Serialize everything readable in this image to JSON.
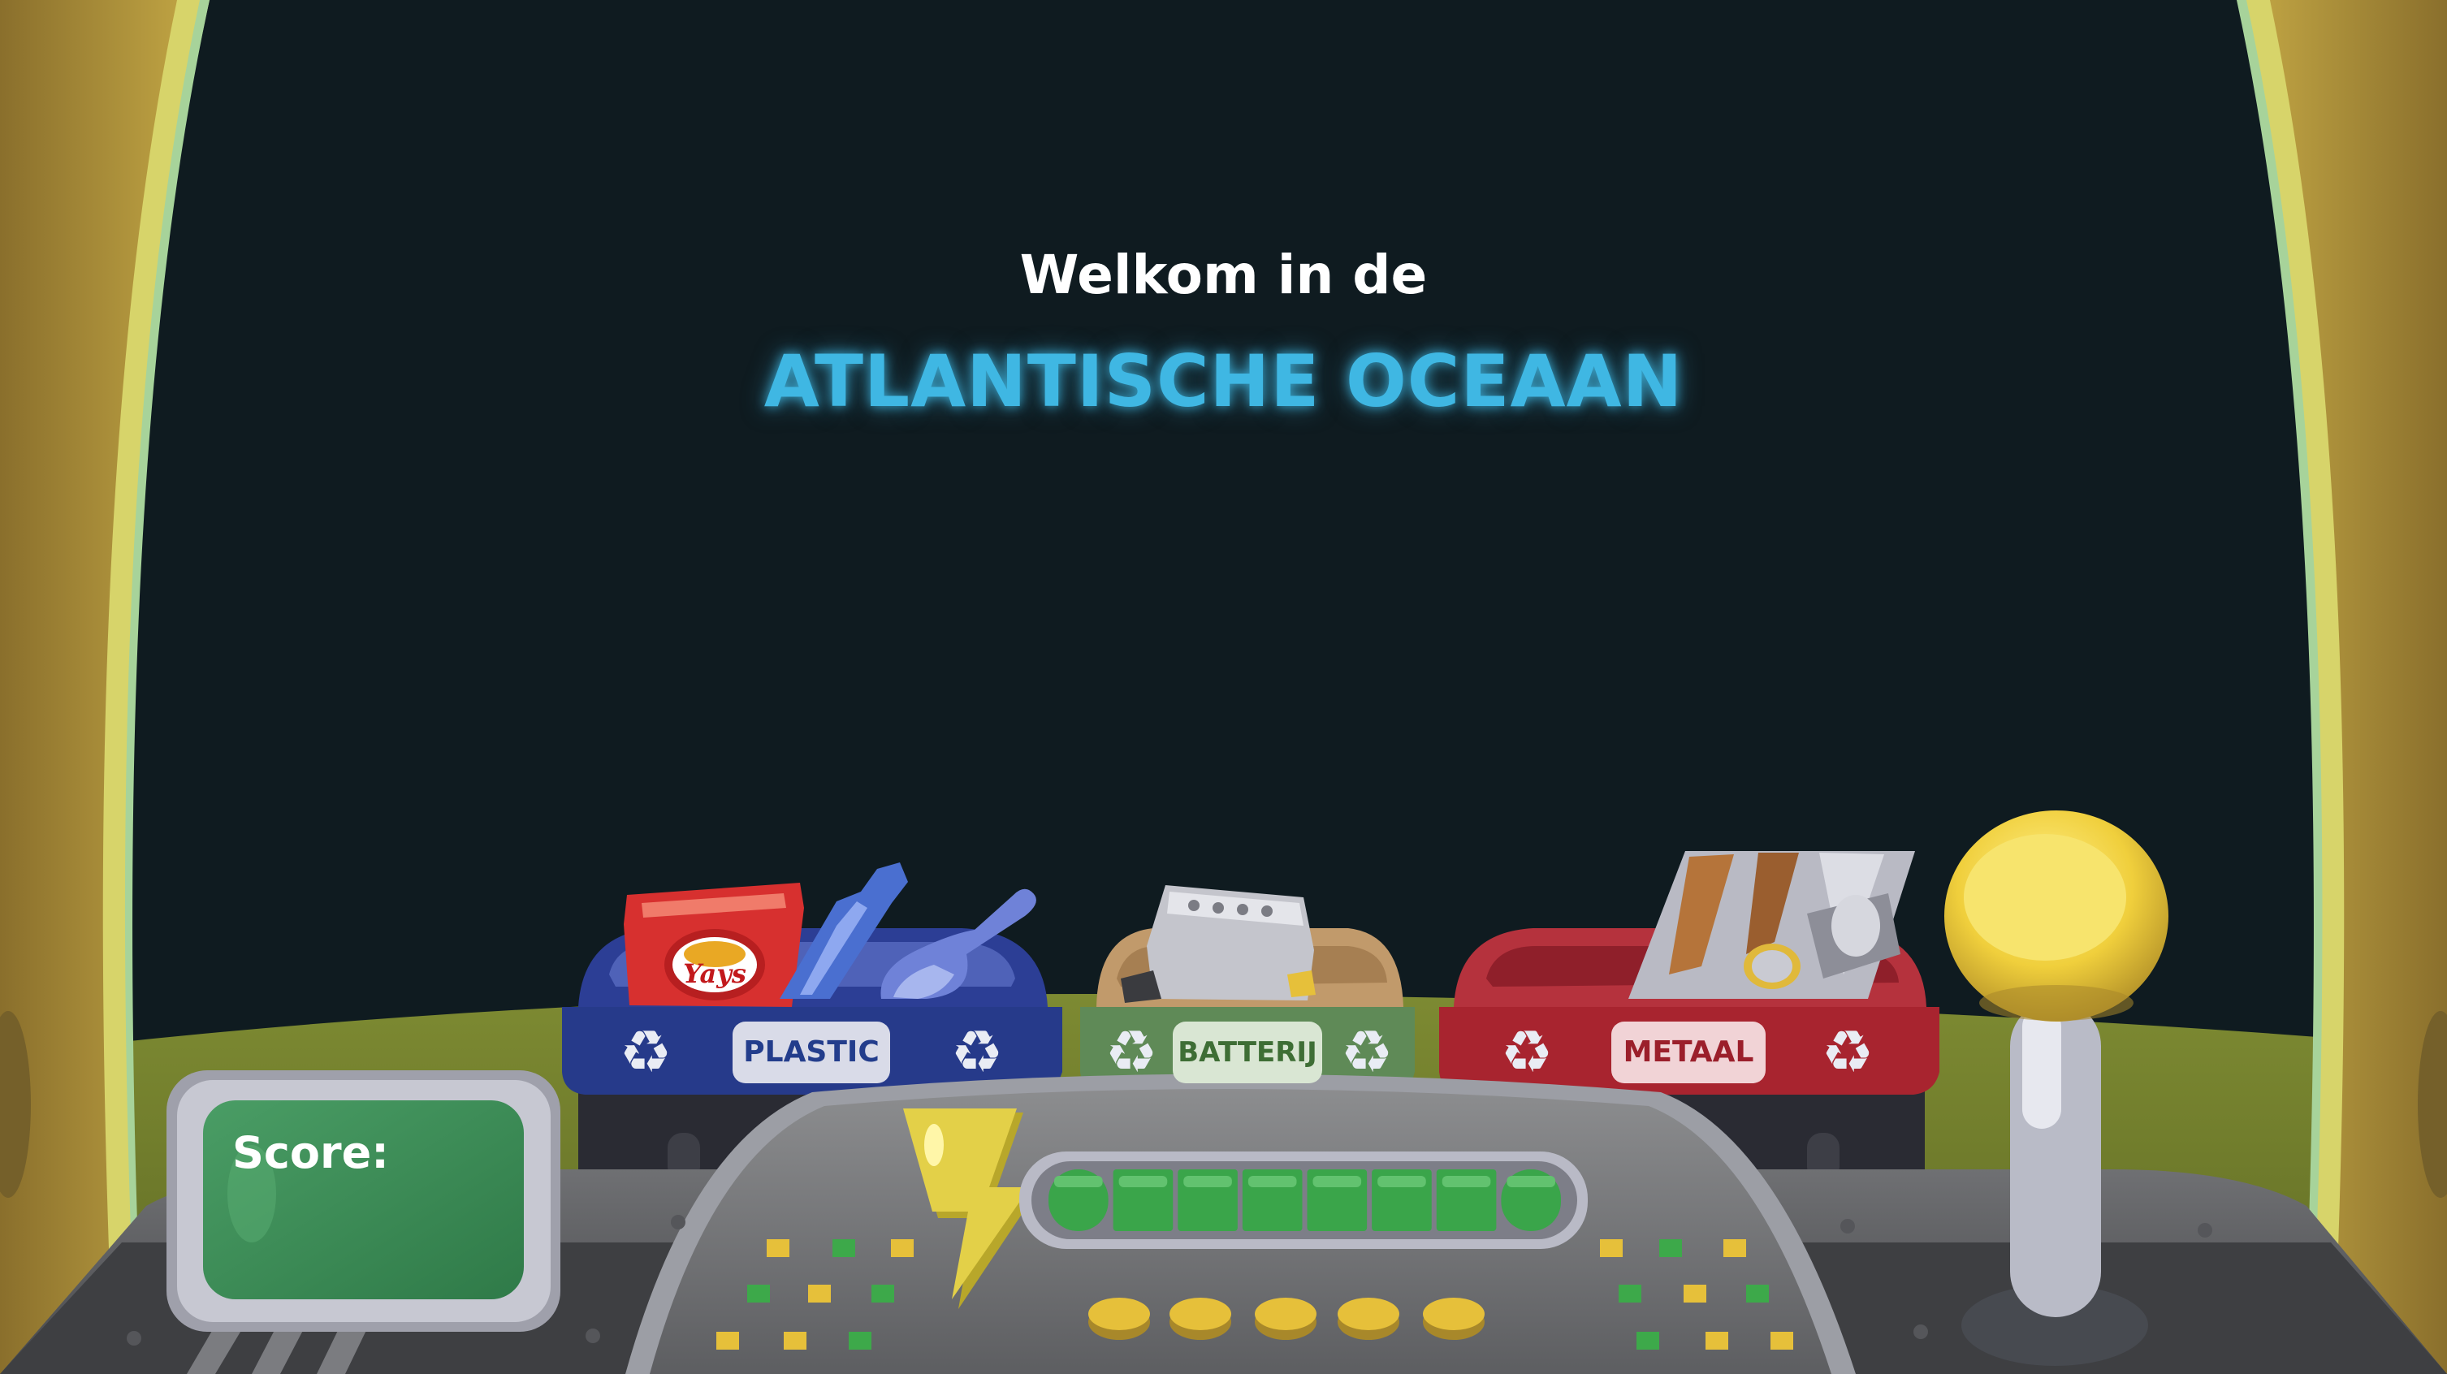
{
  "title": {
    "welcome": "Welkom in de",
    "location": "ATLANTISCHE OCEAAN"
  },
  "bins": [
    {
      "label": "PLASTIC",
      "color": "#263a8a",
      "icon": "recycle-icon"
    },
    {
      "label": "BATTERIJ",
      "color": "#5f8a57",
      "icon": "recycle-icon"
    },
    {
      "label": "METAAL",
      "color": "#a8242f",
      "icon": "recycle-icon"
    }
  ],
  "score": {
    "label": "Score:",
    "value": ""
  },
  "energy": {
    "filled_segments": 8,
    "total_segments": 8,
    "icon": "lightning-icon"
  },
  "colors": {
    "space": "#0f1b20",
    "ground": "#6d7a2a",
    "frame": "#b59a3d",
    "accent": "#3fb7e3",
    "screen_green": "#3f8f5a",
    "energy_green": "#3aa54a"
  }
}
